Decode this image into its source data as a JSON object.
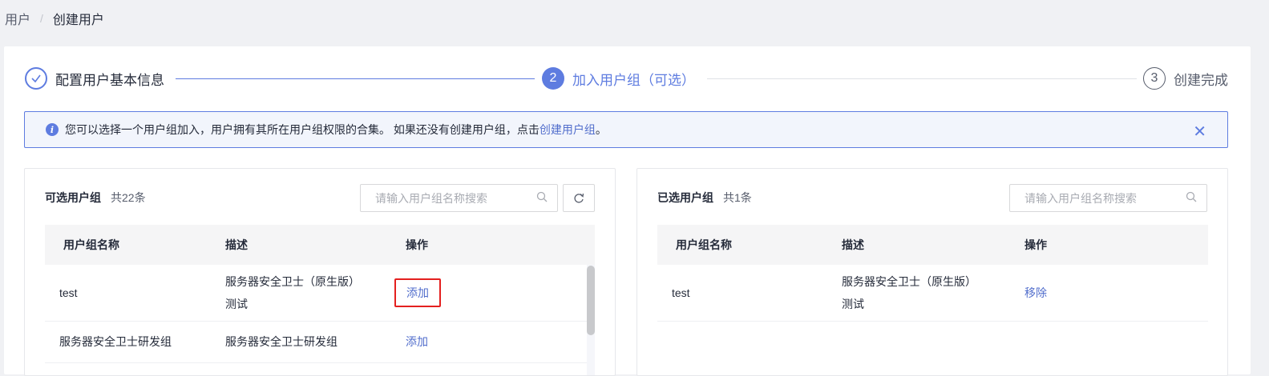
{
  "breadcrumb": {
    "parent": "用户",
    "separator": "/",
    "current": "创建用户"
  },
  "steps": [
    {
      "label": "配置用户基本信息",
      "number": "",
      "state": "done"
    },
    {
      "label": "加入用户组（可选）",
      "number": "2",
      "state": "active"
    },
    {
      "label": "创建完成",
      "number": "3",
      "state": "pending"
    }
  ],
  "alert": {
    "text": "您可以选择一个用户组加入，用户拥有其所在用户组权限的合集。 如果还没有创建用户组，点击 ",
    "link": "创建用户组",
    "suffix": "。"
  },
  "available": {
    "title": "可选用户组",
    "count": "共22条",
    "search_placeholder": "请输入用户组名称搜索",
    "columns": [
      "用户组名称",
      "描述",
      "操作"
    ],
    "rows": [
      {
        "name": "test",
        "desc_line1": "服务器安全卫士（原生版）",
        "desc_line2": "测试",
        "action": "添加"
      },
      {
        "name": "服务器安全卫士研发组",
        "desc_line1": "服务器安全卫士研发组",
        "action": "添加"
      }
    ]
  },
  "selected": {
    "title": "已选用户组",
    "count": "共1条",
    "search_placeholder": "请输入用户组名称搜索",
    "columns": [
      "用户组名称",
      "描述",
      "操作"
    ],
    "rows": [
      {
        "name": "test",
        "desc_line1": "服务器安全卫士（原生版）",
        "desc_line2": "测试",
        "action": "移除"
      }
    ]
  },
  "colors": {
    "accent": "#5e7ce0",
    "link": "#526ecc",
    "highlight": "#e4201f"
  }
}
